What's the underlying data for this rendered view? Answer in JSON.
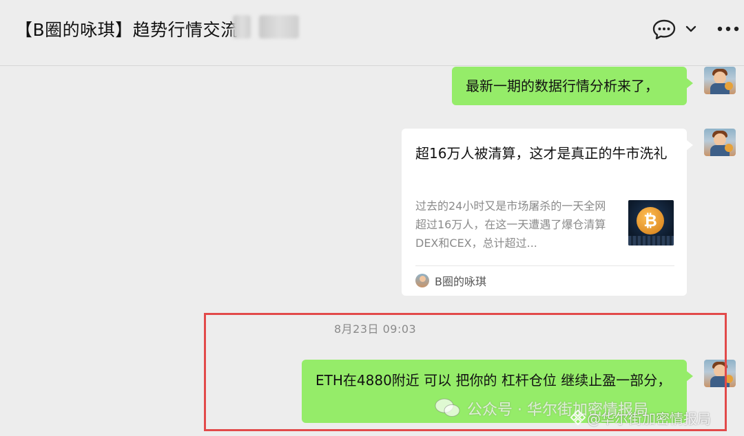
{
  "header": {
    "title": "【B圈的咏琪】趋势行情交流",
    "chat_icon": "chat-bubble-icon",
    "dropdown_icon": "chevron-down-icon",
    "more_icon": "more-icon"
  },
  "messages": {
    "msg1": {
      "text": "最新一期的数据行情分析来了，"
    },
    "card": {
      "title": "超16万人被清算，这才是真正的牛市洗礼",
      "description": "过去的24小时又是市场屠杀的一天全网超过16万人，在这一天遭遇了爆仓清算DEX和CEX，总计超过...",
      "source": "B圈的咏琪"
    },
    "timestamp": "8月23日 09:03",
    "msg2": {
      "text": "ETH在4880附近 可以 把你的 杠杆仓位 继续止盈一部分，"
    }
  },
  "watermark": {
    "wechat_label": "公众号 · 华尔街加密情报局",
    "brand_label": "@华尔街加密情报局"
  },
  "colors": {
    "background": "#ededed",
    "sent_bubble": "#95ec69",
    "highlight_box": "#e24a4a"
  }
}
